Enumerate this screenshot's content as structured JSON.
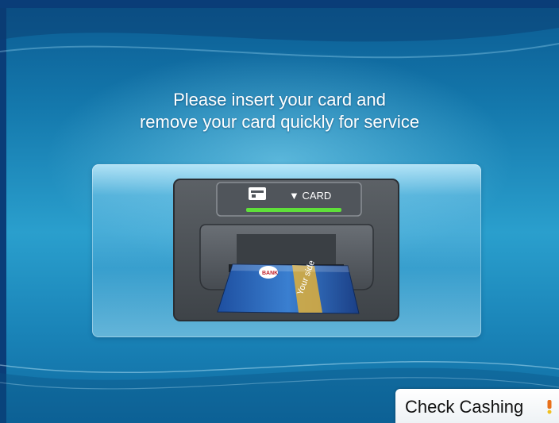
{
  "prompt": {
    "line1": "Please insert your card and",
    "line2": "remove your card quickly for service"
  },
  "card_reader": {
    "indicator_label": "▼ CARD",
    "indicator_color": "#5fe03a",
    "card_text": [
      "BANK",
      "Your side"
    ]
  },
  "check_cashing_button": {
    "label": "Check Cashing",
    "accent_color": "#e8701a"
  },
  "icons": [
    "card-slot-icon",
    "bank-card-icon",
    "warning-icon"
  ],
  "colors": {
    "background_top": "#0b5a91",
    "background_mid": "#2a9fcd",
    "text": "#ffffff"
  }
}
